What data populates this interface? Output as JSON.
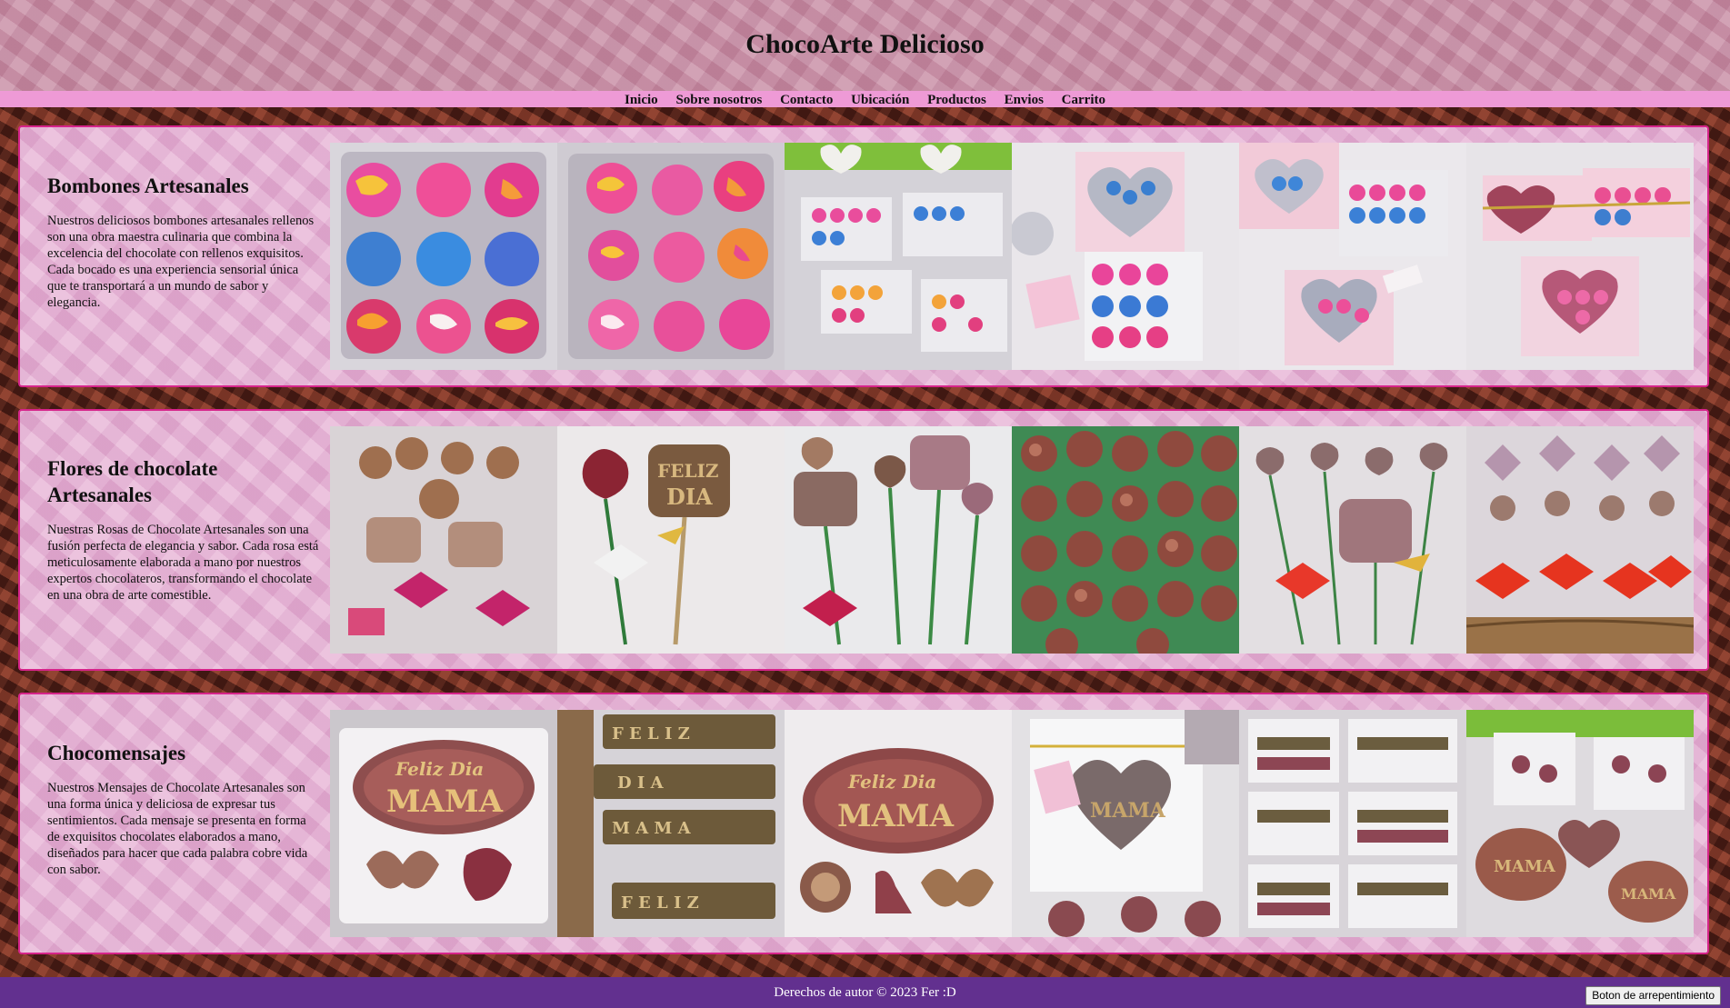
{
  "header": {
    "title": "ChocoArte Delicioso"
  },
  "nav": {
    "items": [
      "Inicio",
      "Sobre nosotros",
      "Contacto",
      "Ubicación",
      "Productos",
      "Envios",
      "Carrito"
    ]
  },
  "sections": [
    {
      "title": "Bombones Artesanales",
      "description": "Nuestros deliciosos bombones artesanales rellenos son una obra maestra culinaria que combina la excelencia del chocolate con rellenos exquisitos. Cada bocado es una experiencia sensorial única que te transportará a un mundo de sabor y elegancia."
    },
    {
      "title": "Flores de chocolate Artesanales",
      "description": "Nuestras Rosas de Chocolate Artesanales son una fusión perfecta de elegancia y sabor. Cada rosa está meticulosamente elaborada a mano por nuestros expertos chocolateros, transformando el chocolate en una obra de arte comestible."
    },
    {
      "title": "Chocomensajes",
      "description": "Nuestros Mensajes de Chocolate Artesanales son una forma única y deliciosa de expresar tus sentimientos. Cada mensaje se presenta en forma de exquisitos chocolates elaborados a mano, diseñados para hacer que cada palabra cobre vida con sabor."
    }
  ],
  "footer": {
    "copyright": "Derechos de autor © 2023 Fer :D",
    "button_label": "Boton de arrepentimiento"
  },
  "colors": {
    "nav_bg": "#ee9ad6",
    "section_border": "#d6248a",
    "footer_bg": "#62308f"
  }
}
